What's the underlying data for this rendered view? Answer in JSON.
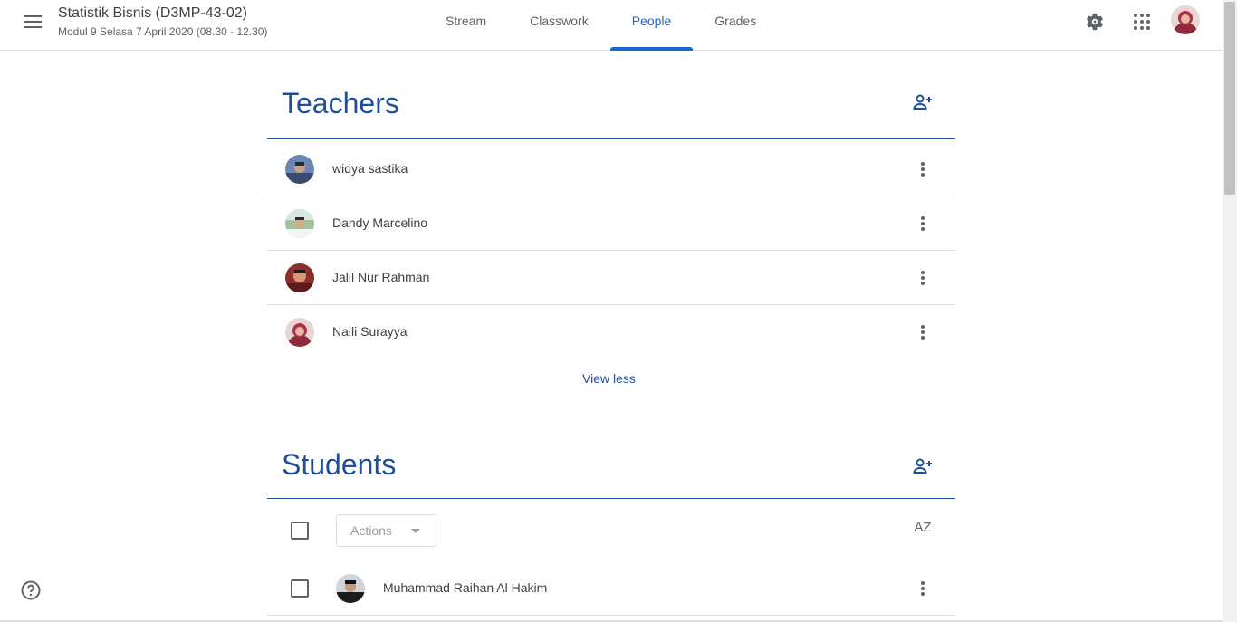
{
  "header": {
    "course_title": "Statistik Bisnis (D3MP-43-02)",
    "course_subtitle": "Modul 9 Selasa 7 April 2020 (08.30 - 12.30)",
    "tabs": [
      {
        "label": "Stream",
        "active": false
      },
      {
        "label": "Classwork",
        "active": false
      },
      {
        "label": "People",
        "active": true
      },
      {
        "label": "Grades",
        "active": false
      }
    ],
    "icons": [
      "menu-icon",
      "settings-gear-icon",
      "apps-grid-icon",
      "account-avatar"
    ]
  },
  "teachers": {
    "title": "Teachers",
    "add_icon": "person-add-icon",
    "people": [
      {
        "name": "widya sastika"
      },
      {
        "name": "Dandy Marcelino"
      },
      {
        "name": "Jalil Nur Rahman"
      },
      {
        "name": "Naili Surayya"
      }
    ],
    "view_less_label": "View less"
  },
  "students": {
    "title": "Students",
    "add_icon": "person-add-icon",
    "actions_label": "Actions",
    "sort_label": "AZ",
    "people": [
      {
        "name": "Muhammad Raihan Al Hakim"
      }
    ]
  },
  "colors": {
    "accent": "#1e4e9d",
    "tab_active": "#1967d2",
    "text": "#3c4043",
    "muted": "#5f6368"
  }
}
